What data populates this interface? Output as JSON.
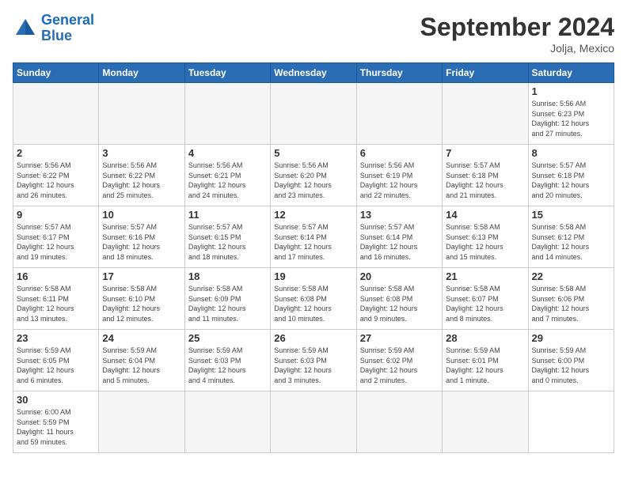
{
  "logo": {
    "line1": "General",
    "line2": "Blue"
  },
  "title": "September 2024",
  "location": "Jolja, Mexico",
  "days_of_week": [
    "Sunday",
    "Monday",
    "Tuesday",
    "Wednesday",
    "Thursday",
    "Friday",
    "Saturday"
  ],
  "cells": [
    {
      "day": "",
      "info": ""
    },
    {
      "day": "",
      "info": ""
    },
    {
      "day": "",
      "info": ""
    },
    {
      "day": "",
      "info": ""
    },
    {
      "day": "",
      "info": ""
    },
    {
      "day": "",
      "info": ""
    },
    {
      "day": "1",
      "info": "Sunrise: 5:56 AM\nSunset: 6:23 PM\nDaylight: 12 hours\nand 27 minutes."
    },
    {
      "day": "2",
      "info": "Sunrise: 5:56 AM\nSunset: 6:22 PM\nDaylight: 12 hours\nand 26 minutes."
    },
    {
      "day": "3",
      "info": "Sunrise: 5:56 AM\nSunset: 6:22 PM\nDaylight: 12 hours\nand 25 minutes."
    },
    {
      "day": "4",
      "info": "Sunrise: 5:56 AM\nSunset: 6:21 PM\nDaylight: 12 hours\nand 24 minutes."
    },
    {
      "day": "5",
      "info": "Sunrise: 5:56 AM\nSunset: 6:20 PM\nDaylight: 12 hours\nand 23 minutes."
    },
    {
      "day": "6",
      "info": "Sunrise: 5:56 AM\nSunset: 6:19 PM\nDaylight: 12 hours\nand 22 minutes."
    },
    {
      "day": "7",
      "info": "Sunrise: 5:57 AM\nSunset: 6:18 PM\nDaylight: 12 hours\nand 21 minutes."
    },
    {
      "day": "8",
      "info": "Sunrise: 5:57 AM\nSunset: 6:18 PM\nDaylight: 12 hours\nand 20 minutes."
    },
    {
      "day": "9",
      "info": "Sunrise: 5:57 AM\nSunset: 6:17 PM\nDaylight: 12 hours\nand 19 minutes."
    },
    {
      "day": "10",
      "info": "Sunrise: 5:57 AM\nSunset: 6:16 PM\nDaylight: 12 hours\nand 18 minutes."
    },
    {
      "day": "11",
      "info": "Sunrise: 5:57 AM\nSunset: 6:15 PM\nDaylight: 12 hours\nand 18 minutes."
    },
    {
      "day": "12",
      "info": "Sunrise: 5:57 AM\nSunset: 6:14 PM\nDaylight: 12 hours\nand 17 minutes."
    },
    {
      "day": "13",
      "info": "Sunrise: 5:57 AM\nSunset: 6:14 PM\nDaylight: 12 hours\nand 16 minutes."
    },
    {
      "day": "14",
      "info": "Sunrise: 5:58 AM\nSunset: 6:13 PM\nDaylight: 12 hours\nand 15 minutes."
    },
    {
      "day": "15",
      "info": "Sunrise: 5:58 AM\nSunset: 6:12 PM\nDaylight: 12 hours\nand 14 minutes."
    },
    {
      "day": "16",
      "info": "Sunrise: 5:58 AM\nSunset: 6:11 PM\nDaylight: 12 hours\nand 13 minutes."
    },
    {
      "day": "17",
      "info": "Sunrise: 5:58 AM\nSunset: 6:10 PM\nDaylight: 12 hours\nand 12 minutes."
    },
    {
      "day": "18",
      "info": "Sunrise: 5:58 AM\nSunset: 6:09 PM\nDaylight: 12 hours\nand 11 minutes."
    },
    {
      "day": "19",
      "info": "Sunrise: 5:58 AM\nSunset: 6:08 PM\nDaylight: 12 hours\nand 10 minutes."
    },
    {
      "day": "20",
      "info": "Sunrise: 5:58 AM\nSunset: 6:08 PM\nDaylight: 12 hours\nand 9 minutes."
    },
    {
      "day": "21",
      "info": "Sunrise: 5:58 AM\nSunset: 6:07 PM\nDaylight: 12 hours\nand 8 minutes."
    },
    {
      "day": "22",
      "info": "Sunrise: 5:58 AM\nSunset: 6:06 PM\nDaylight: 12 hours\nand 7 minutes."
    },
    {
      "day": "23",
      "info": "Sunrise: 5:59 AM\nSunset: 6:05 PM\nDaylight: 12 hours\nand 6 minutes."
    },
    {
      "day": "24",
      "info": "Sunrise: 5:59 AM\nSunset: 6:04 PM\nDaylight: 12 hours\nand 5 minutes."
    },
    {
      "day": "25",
      "info": "Sunrise: 5:59 AM\nSunset: 6:03 PM\nDaylight: 12 hours\nand 4 minutes."
    },
    {
      "day": "26",
      "info": "Sunrise: 5:59 AM\nSunset: 6:03 PM\nDaylight: 12 hours\nand 3 minutes."
    },
    {
      "day": "27",
      "info": "Sunrise: 5:59 AM\nSunset: 6:02 PM\nDaylight: 12 hours\nand 2 minutes."
    },
    {
      "day": "28",
      "info": "Sunrise: 5:59 AM\nSunset: 6:01 PM\nDaylight: 12 hours\nand 1 minute."
    },
    {
      "day": "29",
      "info": "Sunrise: 5:59 AM\nSunset: 6:00 PM\nDaylight: 12 hours\nand 0 minutes."
    },
    {
      "day": "30",
      "info": "Sunrise: 6:00 AM\nSunset: 5:59 PM\nDaylight: 11 hours\nand 59 minutes."
    },
    {
      "day": "",
      "info": ""
    },
    {
      "day": "",
      "info": ""
    },
    {
      "day": "",
      "info": ""
    },
    {
      "day": "",
      "info": ""
    },
    {
      "day": "",
      "info": ""
    }
  ]
}
